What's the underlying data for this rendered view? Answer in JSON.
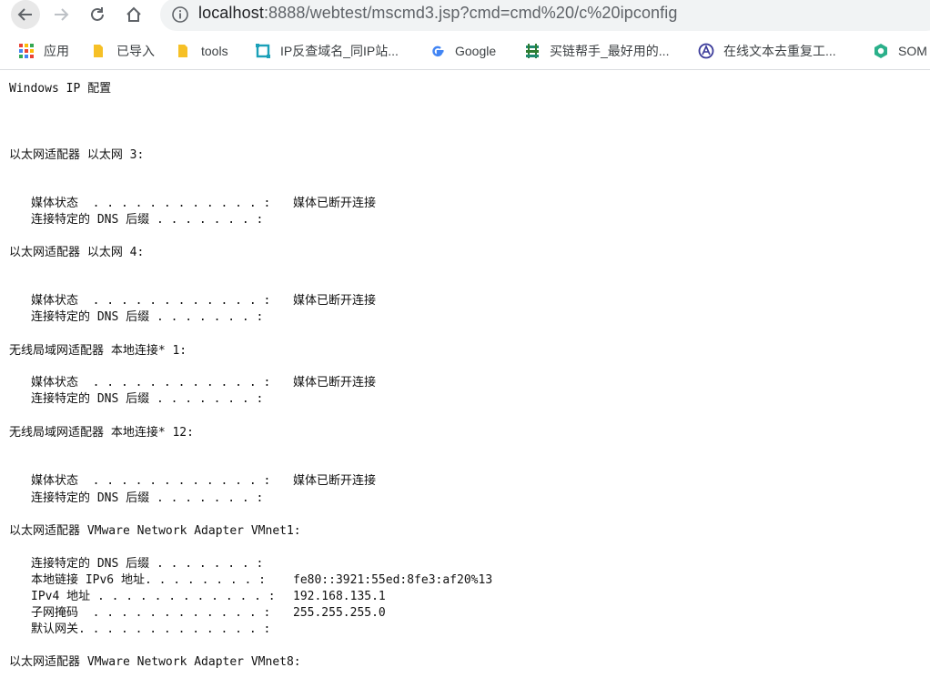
{
  "browser": {
    "url_host": "localhost",
    "url_path": ":8888/webtest/mscmd3.jsp?cmd=cmd%20/c%20ipconfig",
    "bookmarks": [
      {
        "label": "应用",
        "icon": "apps-grid-icon"
      },
      {
        "label": "已导入",
        "icon": "folder-icon"
      },
      {
        "label": "tools",
        "icon": "folder-icon"
      },
      {
        "label": "IP反查域名_同IP站...",
        "icon": "ip-site-icon"
      },
      {
        "label": "Google",
        "icon": "google-icon"
      },
      {
        "label": "买链帮手_最好用的...",
        "icon": "link-helper-icon"
      },
      {
        "label": "在线文本去重复工...",
        "icon": "dedupe-tool-icon"
      },
      {
        "label": "SOM",
        "icon": "som-icon"
      }
    ]
  },
  "output": {
    "title": "Windows IP 配置",
    "adapters": [
      {
        "heading": "以太网适配器 以太网 3:",
        "media_label": "媒体状态  . . . . . . . . . . . . :",
        "media_value": "媒体已断开连接",
        "dns_label": "连接特定的 DNS 后缀 . . . . . . . :"
      },
      {
        "heading": "以太网适配器 以太网 4:",
        "media_label": "媒体状态  . . . . . . . . . . . . :",
        "media_value": "媒体已断开连接",
        "dns_label": "连接特定的 DNS 后缀 . . . . . . . :"
      },
      {
        "heading": "无线局域网适配器 本地连接* 1:",
        "media_label": "媒体状态  . . . . . . . . . . . . :",
        "media_value": "媒体已断开连接",
        "dns_label": "连接特定的 DNS 后缀 . . . . . . . :"
      },
      {
        "heading": "无线局域网适配器 本地连接* 12:",
        "media_label": "媒体状态  . . . . . . . . . . . . :",
        "media_value": "媒体已断开连接",
        "dns_label": "连接特定的 DNS 后缀 . . . . . . . :"
      }
    ],
    "vmnet1": {
      "heading": "以太网适配器 VMware Network Adapter VMnet1:",
      "dns_label": "连接特定的 DNS 后缀 . . . . . . . :",
      "ipv6_label": "本地链接 IPv6 地址. . . . . . . . :",
      "ipv6_value": "fe80::3921:55ed:8fe3:af20%13",
      "ipv4_label": "IPv4 地址 . . . . . . . . . . . . :",
      "ipv4_value": "192.168.135.1",
      "mask_label": "子网掩码  . . . . . . . . . . . . :",
      "mask_value": "255.255.255.0",
      "gateway_label": "默认网关. . . . . . . . . . . . . :"
    },
    "vmnet8_heading": "以太网适配器 VMware Network Adapter VMnet8:"
  }
}
